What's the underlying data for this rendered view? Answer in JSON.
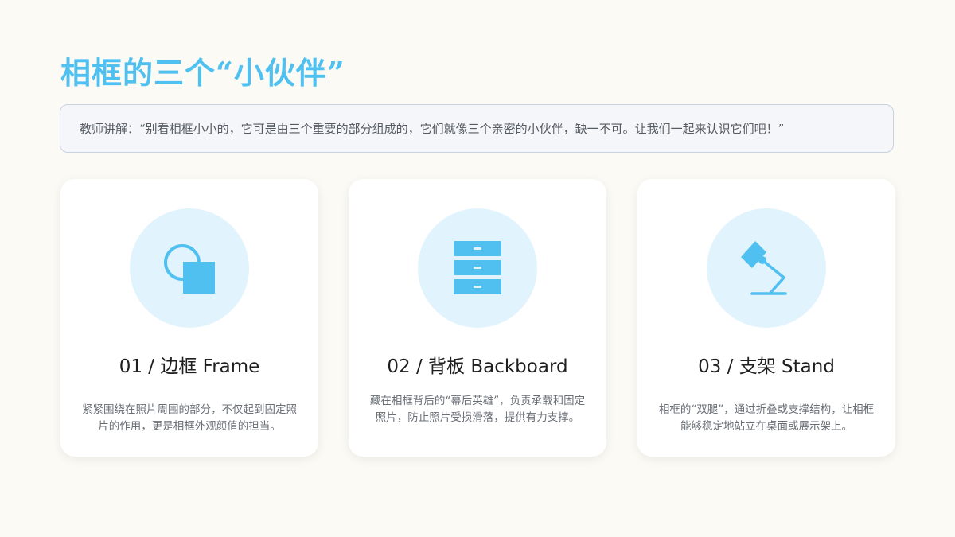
{
  "title": "相框的三个“小伙伴”",
  "speech": "教师讲解：“别看相框小小的，它可是由三个重要的部分组成的，它们就像三个亲密的小伙伴，缺一不可。让我们一起来认识它们吧！”",
  "accent_color": "#4fc0ef",
  "cards": [
    {
      "icon": "frame-shapes-icon",
      "title": "01 / 边框 Frame",
      "desc": "紧紧围绕在照片周围的部分，不仅起到固定照片的作用，更是相框外观颜值的担当。"
    },
    {
      "icon": "drawer-cabinet-icon",
      "title": "02 / 背板 Backboard",
      "desc": "藏在相框背后的“幕后英雄”，负责承载和固定照片，防止照片受损滑落，提供有力支撑。"
    },
    {
      "icon": "desk-lamp-icon",
      "title": "03 / 支架 Stand",
      "desc": "相框的“双腿”，通过折叠或支撑结构，让相框能够稳定地站立在桌面或展示架上。"
    }
  ]
}
